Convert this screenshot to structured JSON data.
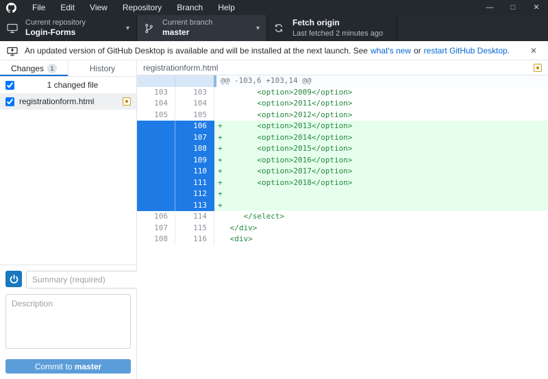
{
  "titlebar": {
    "menus": [
      "File",
      "Edit",
      "View",
      "Repository",
      "Branch",
      "Help"
    ],
    "window_controls": [
      {
        "name": "minimize",
        "glyph": "—"
      },
      {
        "name": "maximize",
        "glyph": "□"
      },
      {
        "name": "close",
        "glyph": "✕"
      }
    ]
  },
  "toolbar": {
    "repository": {
      "label": "Current repository",
      "value": "Login-Forms"
    },
    "branch": {
      "label": "Current branch",
      "value": "master"
    },
    "fetch": {
      "label": "Fetch origin",
      "sublabel": "Last fetched 2 minutes ago"
    }
  },
  "banner": {
    "message": "An updated version of GitHub Desktop is available and will be installed at the next launch. See",
    "whats_new_link": "what's new",
    "conjunction": "or",
    "restart_link": "restart GitHub Desktop.",
    "close_glyph": "✕"
  },
  "sidebar": {
    "tabs": [
      {
        "id": "changes",
        "label": "Changes",
        "badge": "1",
        "active": true
      },
      {
        "id": "history",
        "label": "History",
        "active": false
      }
    ],
    "changed_files_label": "1 changed file",
    "files": [
      {
        "name": "registrationform.html",
        "status": "modified",
        "checked": true
      }
    ],
    "commit": {
      "summary_placeholder": "Summary (required)",
      "description_placeholder": "Description",
      "button_prefix": "Commit to ",
      "button_branch": "master"
    }
  },
  "diff": {
    "file_name": "registrationform.html",
    "file_status": "modified",
    "hunk_header": "@@ -103,6 +103,14 @@",
    "lines": [
      {
        "old": "103",
        "new": "103",
        "type": "context",
        "marker": "",
        "text": "       <option>2009</option>"
      },
      {
        "old": "104",
        "new": "104",
        "type": "context",
        "marker": "",
        "text": "       <option>2011</option>"
      },
      {
        "old": "105",
        "new": "105",
        "type": "context",
        "marker": "",
        "text": "       <option>2012</option>"
      },
      {
        "old": "",
        "new": "106",
        "type": "added",
        "marker": "+",
        "text": "       <option>2013</option>"
      },
      {
        "old": "",
        "new": "107",
        "type": "added",
        "marker": "+",
        "text": "       <option>2014</option>"
      },
      {
        "old": "",
        "new": "108",
        "type": "added",
        "marker": "+",
        "text": "       <option>2015</option>"
      },
      {
        "old": "",
        "new": "109",
        "type": "added",
        "marker": "+",
        "text": "       <option>2016</option>"
      },
      {
        "old": "",
        "new": "110",
        "type": "added",
        "marker": "+",
        "text": "       <option>2017</option>"
      },
      {
        "old": "",
        "new": "111",
        "type": "added",
        "marker": "+",
        "text": "       <option>2018</option>"
      },
      {
        "old": "",
        "new": "112",
        "type": "added",
        "marker": "+",
        "text": ""
      },
      {
        "old": "",
        "new": "113",
        "type": "added",
        "marker": "+",
        "text": ""
      },
      {
        "old": "106",
        "new": "114",
        "type": "context",
        "marker": "",
        "text": "    </select>"
      },
      {
        "old": "107",
        "new": "115",
        "type": "context",
        "marker": "",
        "text": " </div>"
      },
      {
        "old": "108",
        "new": "116",
        "type": "context",
        "marker": "",
        "text": " <div>"
      }
    ]
  },
  "colors": {
    "accent_blue": "#0366d6",
    "selected_line_blue": "#1e7ae5",
    "added_bg": "#e6ffed",
    "code_green": "#24883d",
    "modified_yellow": "#bf8700",
    "commit_button_blue": "#5b9dd9",
    "titlebar_dark": "#24292e"
  }
}
